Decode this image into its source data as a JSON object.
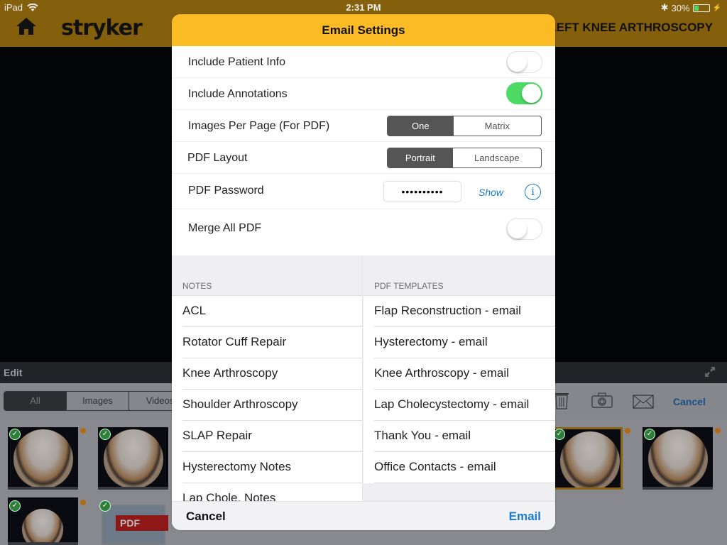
{
  "status_bar": {
    "device": "iPad",
    "time": "2:31 PM",
    "battery": "30%",
    "battery_level": 0.3
  },
  "header": {
    "logo": "stryker",
    "procedure_title": "LEFT KNEE ARTHROSCOPY"
  },
  "gallery": {
    "edit_label": "Edit",
    "filters": [
      {
        "label": "All",
        "active": true
      },
      {
        "label": "Images",
        "active": false
      },
      {
        "label": "Videos",
        "active": false
      }
    ],
    "cancel_label": "Cancel",
    "pdf_badge": "PDF"
  },
  "modal": {
    "title": "Email Settings",
    "settings": {
      "include_patient_info": {
        "label": "Include Patient Info",
        "on": false
      },
      "include_annotations": {
        "label": "Include Annotations",
        "on": true
      },
      "images_per_page": {
        "label": "Images Per Page (For PDF)",
        "options": [
          "One",
          "Matrix"
        ],
        "selected": "One"
      },
      "pdf_layout": {
        "label": "PDF Layout",
        "options": [
          "Portrait",
          "Landscape"
        ],
        "selected": "Portrait"
      },
      "pdf_password": {
        "label": "PDF Password",
        "value_masked": "••••••••••",
        "show_label": "Show"
      },
      "merge_all_pdf": {
        "label": "Merge All PDF",
        "on": false
      }
    },
    "notes": {
      "header": "NOTES",
      "items": [
        "ACL",
        "Rotator Cuff Repair",
        "Knee Arthroscopy",
        "Shoulder Arthroscopy",
        "SLAP Repair",
        "Hysterectomy Notes",
        "Lap Chole. Notes"
      ]
    },
    "templates": {
      "header": "PDF TEMPLATES",
      "items": [
        "Flap Reconstruction - email",
        "Hysterectomy - email",
        "Knee Arthroscopy - email",
        "Lap Cholecystectomy - email",
        "Thank You - email",
        "Office Contacts - email"
      ]
    },
    "footer": {
      "cancel_label": "Cancel",
      "email_label": "Email"
    }
  }
}
